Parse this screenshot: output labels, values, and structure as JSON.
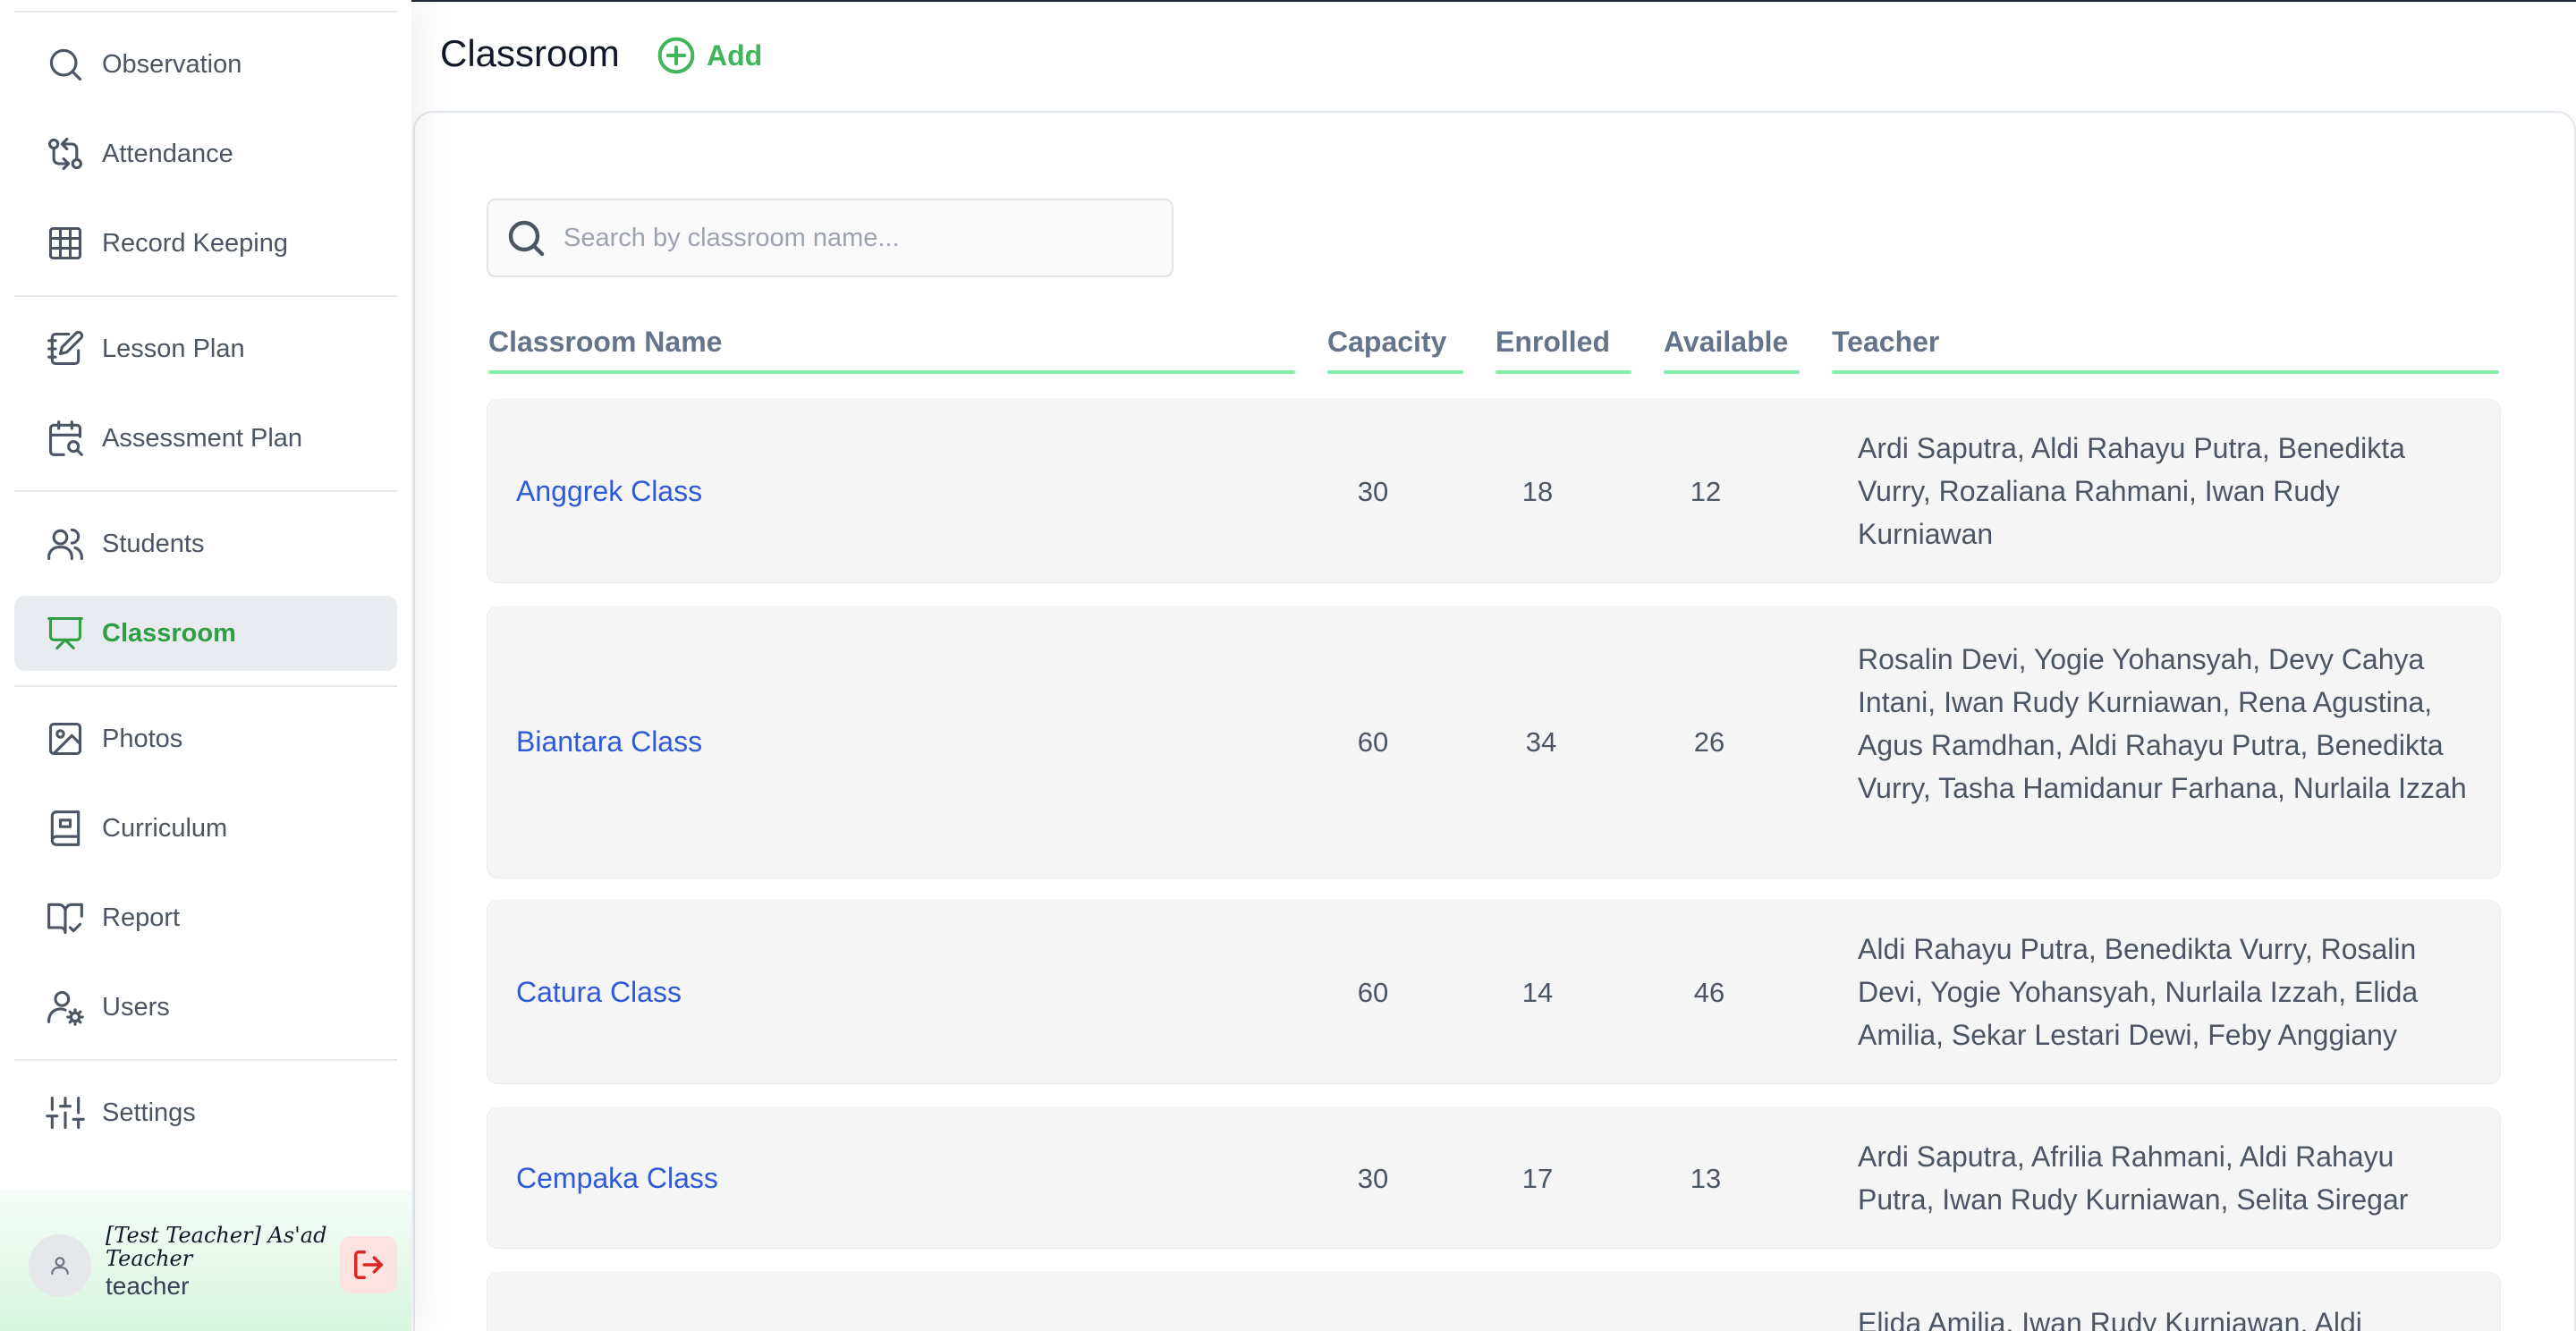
{
  "sidebar": {
    "items": [
      {
        "label": "Observation",
        "icon": "search-icon"
      },
      {
        "label": "Attendance",
        "icon": "git-compare-icon"
      },
      {
        "label": "Record Keeping",
        "icon": "grid-icon"
      },
      {
        "label": "Lesson Plan",
        "icon": "notebook-pen-icon"
      },
      {
        "label": "Assessment Plan",
        "icon": "calendar-search-icon"
      },
      {
        "label": "Students",
        "icon": "users-icon"
      },
      {
        "label": "Classroom",
        "icon": "presentation-icon",
        "active": true
      },
      {
        "label": "Photos",
        "icon": "image-icon"
      },
      {
        "label": "Curriculum",
        "icon": "book-icon"
      },
      {
        "label": "Report",
        "icon": "book-check-icon"
      },
      {
        "label": "Users",
        "icon": "user-cog-icon"
      },
      {
        "label": "Settings",
        "icon": "sliders-icon"
      }
    ],
    "user": {
      "name": "[Test Teacher] As'ad Teacher",
      "role": "teacher"
    }
  },
  "header": {
    "title": "Classroom",
    "add_label": "Add"
  },
  "search": {
    "placeholder": "Search by classroom name..."
  },
  "table": {
    "columns": [
      "Classroom Name",
      "Capacity",
      "Enrolled",
      "Available",
      "Teacher"
    ],
    "rows": [
      {
        "name": "Anggrek Class",
        "capacity": "30",
        "enrolled": "18",
        "available": "12",
        "teachers": "Ardi Saputra, Aldi Rahayu Putra, Benedikta Vurry, Rozaliana Rahmani, Iwan Rudy Kurniawan"
      },
      {
        "name": "Biantara Class",
        "capacity": "60",
        "enrolled": "34",
        "available": "26",
        "teachers": "Rosalin Devi, Yogie Yohansyah, Devy Cahya Intani, Iwan Rudy Kurniawan, Rena Agustina, Agus Ramdhan, Aldi Rahayu Putra, Benedikta Vurry, Tasha Hamidanur Farhana, Nurlaila Izzah"
      },
      {
        "name": "Catura Class",
        "capacity": "60",
        "enrolled": "14",
        "available": "46",
        "teachers": "Aldi Rahayu Putra, Benedikta Vurry, Rosalin Devi, Yogie Yohansyah, Nurlaila Izzah, Elida Amilia, Sekar Lestari Dewi, Feby Anggiany"
      },
      {
        "name": "Cempaka Class",
        "capacity": "30",
        "enrolled": "17",
        "available": "13",
        "teachers": "Ardi Saputra, Afrilia Rahmani, Aldi Rahayu Putra, Iwan Rudy Kurniawan, Selita Siregar"
      },
      {
        "name": "",
        "capacity": "",
        "enrolled": "",
        "available": "",
        "teachers": "Elida Amilia, Iwan Rudy Kurniawan, Aldi"
      }
    ]
  },
  "colors": {
    "accent_green": "#40b55a",
    "active_green": "#2f9e44",
    "link_blue": "#2e59d9",
    "header_underline": "#86efac",
    "logout_red": "#dc2626"
  }
}
